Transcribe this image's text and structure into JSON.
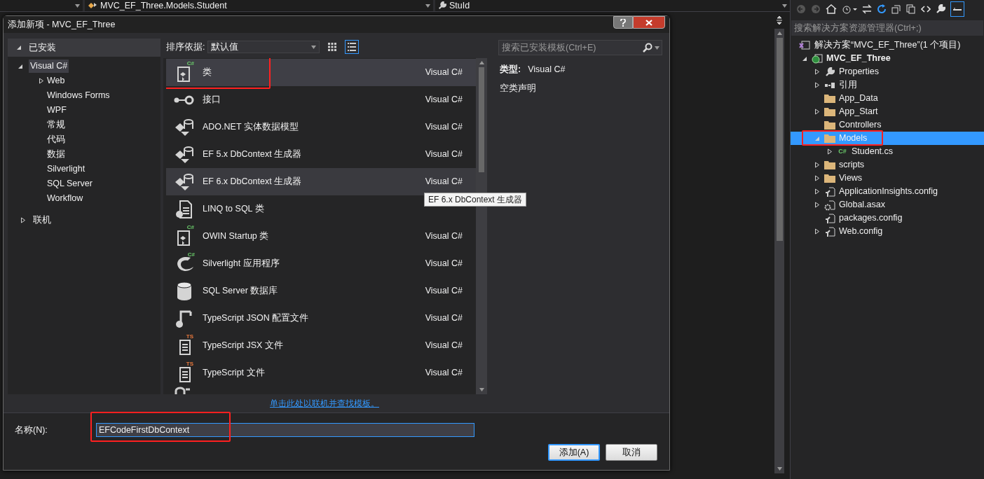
{
  "editor": {
    "nav_type": "MVC_EF_Three.Models.Student",
    "nav_member": "StuId"
  },
  "dialog": {
    "title": "添加新项 - MVC_EF_Three",
    "installed": {
      "label": "已安装",
      "expanded": true
    },
    "categories": [
      {
        "label": "Visual C#",
        "expanded": true,
        "selected": true,
        "children": [
          {
            "label": "Web",
            "expandable": true
          },
          {
            "label": "Windows Forms",
            "expandable": false
          },
          {
            "label": "WPF",
            "expandable": false
          },
          {
            "label": "常规",
            "expandable": false
          },
          {
            "label": "代码",
            "expandable": false
          },
          {
            "label": "数据",
            "expandable": false
          },
          {
            "label": "Silverlight",
            "expandable": false
          },
          {
            "label": "SQL Server",
            "expandable": false
          },
          {
            "label": "Workflow",
            "expandable": false
          }
        ]
      }
    ],
    "online": {
      "label": "联机",
      "expanded": false
    },
    "sort_label": "排序依据:",
    "sort_value": "默认值",
    "view_modes": [
      {
        "kind": "grid",
        "selected": false
      },
      {
        "kind": "list",
        "selected": true
      }
    ],
    "search": {
      "placeholder": "搜索已安装模板(Ctrl+E)"
    },
    "templates": [
      {
        "name": "类",
        "language": "Visual C#",
        "kind": "class",
        "badge": "C#",
        "selected": true,
        "hovered": false
      },
      {
        "name": "接口",
        "language": "Visual C#",
        "kind": "interface",
        "selected": false,
        "hovered": false
      },
      {
        "name": "ADO.NET 实体数据模型",
        "language": "Visual C#",
        "kind": "ef",
        "selected": false,
        "hovered": false
      },
      {
        "name": "EF 5.x DbContext 生成器",
        "language": "Visual C#",
        "kind": "ef",
        "selected": false,
        "hovered": false
      },
      {
        "name": "EF 6.x DbContext 生成器",
        "language": "Visual C#",
        "kind": "ef",
        "selected": false,
        "hovered": true
      },
      {
        "name": "LINQ to SQL 类",
        "kind": "linq",
        "selected": false,
        "hovered": false
      },
      {
        "name": "OWIN Startup 类",
        "language": "Visual C#",
        "kind": "class",
        "badge": "C#",
        "selected": false,
        "hovered": false
      },
      {
        "name": "Silverlight 应用程序",
        "language": "Visual C#",
        "kind": "silverlight",
        "badge": "C#",
        "selected": false,
        "hovered": false
      },
      {
        "name": "SQL Server 数据库",
        "language": "Visual C#",
        "kind": "database",
        "selected": false,
        "hovered": false
      },
      {
        "name": "TypeScript JSON 配置文件",
        "language": "Visual C#",
        "kind": "json",
        "selected": false,
        "hovered": false
      },
      {
        "name": "TypeScript JSX 文件",
        "language": "Visual C#",
        "kind": "ts",
        "badge": "TS",
        "selected": false,
        "hovered": false
      },
      {
        "name": "TypeScript 文件",
        "language": "Visual C#",
        "kind": "ts",
        "badge": "TS",
        "selected": false,
        "hovered": false
      }
    ],
    "tooltip": "EF 6.x DbContext 生成器",
    "details": {
      "type_label": "类型:",
      "type_value": "Visual C#",
      "description": "空类声明"
    },
    "online_link": "单击此处以联机并查找模板。",
    "name_label": "名称(N):",
    "name_value": "EFCodeFirstDbContext",
    "buttons": [
      {
        "label": "添加(A)",
        "focused": true
      },
      {
        "label": "取消",
        "focused": false
      }
    ]
  },
  "solution_explorer": {
    "search": {
      "placeholder": "搜索解决方案资源管理器(Ctrl+;)"
    },
    "solution": "解决方案“MVC_EF_Three”(1 个项目)",
    "tree": [
      {
        "label": "MVC_EF_Three",
        "kind": "project",
        "expandable": true,
        "expanded": true,
        "selected": false,
        "children": [
          {
            "label": "Properties",
            "kind": "wrench",
            "expandable": true,
            "expanded": false,
            "selected": false
          },
          {
            "label": "引用",
            "kind": "refs",
            "expandable": true,
            "expanded": false,
            "selected": false
          },
          {
            "label": "App_Data",
            "kind": "folder",
            "expandable": false,
            "expanded": false,
            "selected": false
          },
          {
            "label": "App_Start",
            "kind": "folder",
            "expandable": true,
            "expanded": false,
            "selected": false
          },
          {
            "label": "Controllers",
            "kind": "folder",
            "expandable": false,
            "expanded": false,
            "selected": false
          },
          {
            "label": "Models",
            "kind": "folder",
            "expandable": true,
            "expanded": true,
            "selected": true,
            "children": [
              {
                "label": "Student.cs",
                "kind": "cs",
                "badge": "C#",
                "expandable": true,
                "expanded": false,
                "selected": false
              }
            ]
          },
          {
            "label": "scripts",
            "kind": "folder",
            "expandable": true,
            "expanded": false,
            "selected": false
          },
          {
            "label": "Views",
            "kind": "folder",
            "expandable": true,
            "expanded": false,
            "selected": false
          },
          {
            "label": "ApplicationInsights.config",
            "kind": "config",
            "expandable": true,
            "expanded": false,
            "selected": false
          },
          {
            "label": "Global.asax",
            "kind": "asax",
            "expandable": true,
            "expanded": false,
            "selected": false
          },
          {
            "label": "packages.config",
            "kind": "config",
            "expandable": false,
            "expanded": false,
            "selected": false
          },
          {
            "label": "Web.config",
            "kind": "config",
            "expandable": true,
            "expanded": false,
            "selected": false
          }
        ]
      }
    ]
  }
}
